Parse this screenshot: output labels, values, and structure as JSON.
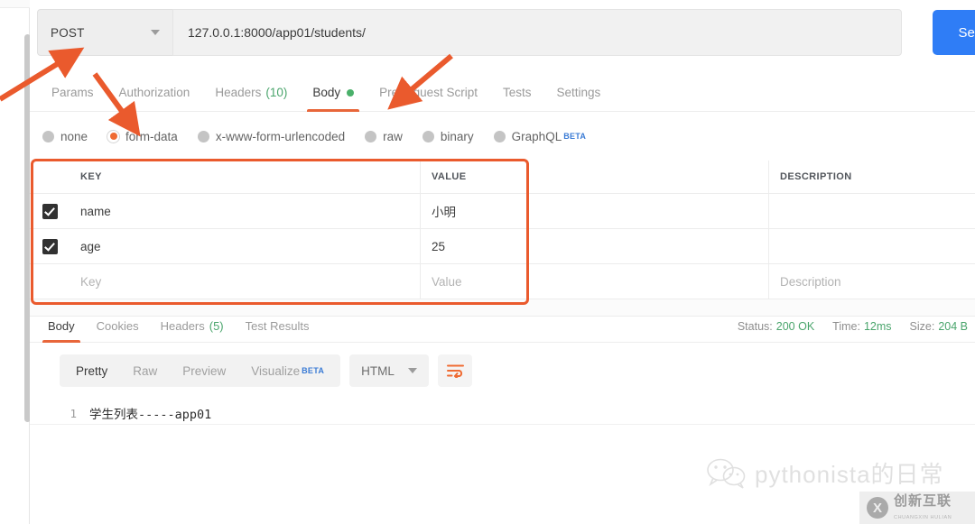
{
  "request": {
    "method": "POST",
    "url": "127.0.0.1:8000/app01/students/",
    "send_label": "Send",
    "tabs": [
      {
        "label": "Params",
        "active": false
      },
      {
        "label": "Authorization",
        "active": false
      },
      {
        "label": "Headers",
        "count": "(10)",
        "active": false
      },
      {
        "label": "Body",
        "active": true,
        "dot": true
      },
      {
        "label": "Pre-request Script",
        "active": false
      },
      {
        "label": "Tests",
        "active": false
      },
      {
        "label": "Settings",
        "active": false
      }
    ],
    "body_types": [
      {
        "label": "none",
        "selected": false
      },
      {
        "label": "form-data",
        "selected": true
      },
      {
        "label": "x-www-form-urlencoded",
        "selected": false
      },
      {
        "label": "raw",
        "selected": false
      },
      {
        "label": "binary",
        "selected": false
      },
      {
        "label": "GraphQL",
        "selected": false,
        "badge": "BETA"
      }
    ]
  },
  "kv_table": {
    "headers": {
      "key": "KEY",
      "value": "VALUE",
      "description": "DESCRIPTION"
    },
    "rows": [
      {
        "checked": true,
        "key": "name",
        "value": "小明",
        "description": ""
      },
      {
        "checked": true,
        "key": "age",
        "value": "25",
        "description": ""
      }
    ],
    "placeholder_row": {
      "key": "Key",
      "value": "Value",
      "description": "Description"
    }
  },
  "response": {
    "tabs": [
      {
        "label": "Body",
        "active": true
      },
      {
        "label": "Cookies",
        "active": false
      },
      {
        "label": "Headers",
        "count": "(5)",
        "active": false
      },
      {
        "label": "Test Results",
        "active": false
      }
    ],
    "meta": {
      "status_label": "Status:",
      "status_value": "200 OK",
      "time_label": "Time:",
      "time_value": "12ms",
      "size_label": "Size:",
      "size_value": "204 B"
    },
    "view_modes": [
      {
        "label": "Pretty",
        "active": true
      },
      {
        "label": "Raw",
        "active": false
      },
      {
        "label": "Preview",
        "active": false
      },
      {
        "label": "Visualize",
        "active": false,
        "badge": "BETA"
      }
    ],
    "format": "HTML",
    "body_lines": [
      {
        "number": "1",
        "text": "学生列表-----app01"
      }
    ]
  },
  "watermark": {
    "text": "pythonista的日常",
    "badge_cn": "创新互联",
    "badge_en": "CHUANGXIN HULIAN",
    "badge_logo": "X"
  },
  "colors": {
    "accent_orange": "#e8663a",
    "annotation_red": "#ea5a2d",
    "send_blue": "#2f7df6",
    "status_green": "#4aa56c",
    "beta_blue": "#3a7bd5"
  }
}
